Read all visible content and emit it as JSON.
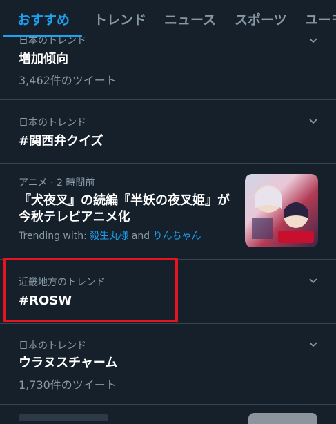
{
  "tabs": [
    {
      "label": "おすすめ"
    },
    {
      "label": "トレンド"
    },
    {
      "label": "ニュース"
    },
    {
      "label": "スポーツ"
    },
    {
      "label": "ユーモア"
    }
  ],
  "items": [
    {
      "meta": "日本のトレンド",
      "title": "増加傾向",
      "count": "3,462件のツイート"
    },
    {
      "meta": "日本のトレンド",
      "title": "#関西弁クイズ"
    },
    {
      "meta": "アニメ · 2 時間前",
      "title_line1": "『犬夜叉』の続編『半妖の夜叉姫』が",
      "title_line2": "今秋テレビアニメ化",
      "with_label": "Trending with:",
      "with_1": "殺生丸様",
      "with_and": "and",
      "with_2": "りんちゃん",
      "thumbnail_icon": "anime-thumbnail"
    },
    {
      "meta": "近畿地方のトレンド",
      "title": "#ROSW"
    },
    {
      "meta": "日本のトレンド",
      "title": "ウラヌスチャーム",
      "count": "1,730件のツイート"
    }
  ],
  "colors": {
    "background": "#15202b",
    "accent": "#1da1f2",
    "secondary_text": "#8899a6",
    "divider": "#38444d",
    "highlight": "#e6141e"
  }
}
